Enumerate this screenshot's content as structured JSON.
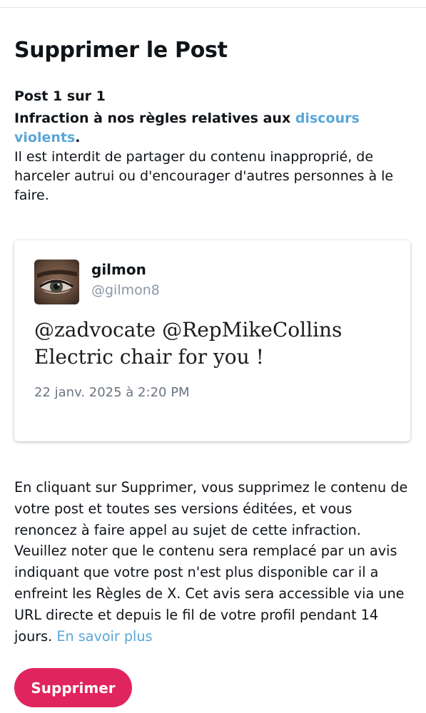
{
  "dialog": {
    "title": "Supprimer le Post",
    "post_count": "Post 1 sur 1",
    "rule_prefix": "Infraction à nos règles relatives aux ",
    "rule_link": "discours violents",
    "rule_suffix": ".",
    "description": "Il est interdit de partager du contenu inapproprié, de harceler autrui ou d'encourager d'autres personnes à le faire."
  },
  "post": {
    "display_name": "gilmon",
    "handle": "@gilmon8",
    "text": "@zadvocate @RepMikeCollins Electric chair for you !",
    "timestamp": "22 janv. 2025 à 2:20 PM",
    "avatar_icon": "user-avatar-icon"
  },
  "notice": {
    "text": "En cliquant sur Supprimer, vous supprimez le contenu de votre post et toutes ses versions éditées, et vous renoncez à faire appel au sujet de cette infraction. Veuillez noter que le contenu sera remplacé par un avis indiquant que votre post n'est plus disponible car il a enfreint les Règles de X. Cet avis sera accessible via une URL directe et depuis le fil de votre profil pendant 14 jours. ",
    "link": "En savoir plus"
  },
  "actions": {
    "delete_label": "Supprimer"
  },
  "colors": {
    "link": "#5aa6d8",
    "delete_button": "#e0245e"
  }
}
